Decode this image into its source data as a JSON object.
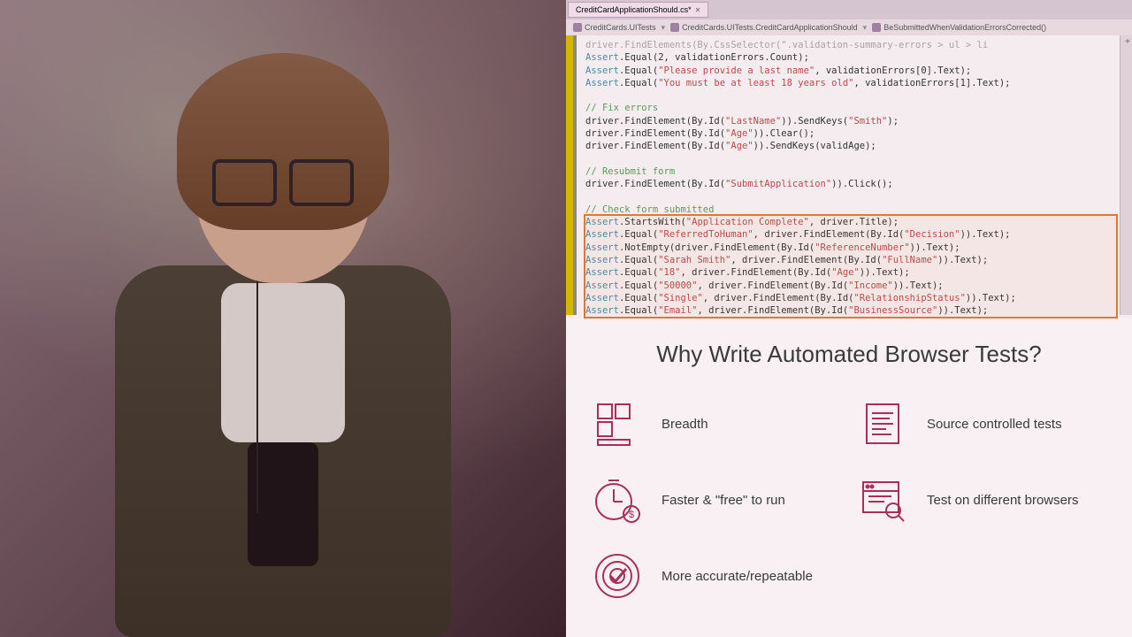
{
  "ide": {
    "tab": {
      "filename": "CreditCardApplicationShould.cs*",
      "close_glyph": "✕"
    },
    "breadcrumb": {
      "project": "CreditCards.UITests",
      "class": "CreditCards.UITests.CreditCardApplicationShould",
      "method": "BeSubmittedWhenValidationErrorsCorrected()"
    },
    "code": {
      "l01a": "driver.FindElements(By.CssSelector(\".validation-summary-errors > ul > li",
      "l02a": "Assert",
      "l02b": ".Equal(",
      "l02c": "2",
      "l02d": ", validationErrors.Count);",
      "l03a": "Assert",
      "l03b": ".Equal(",
      "l03c": "\"Please provide a last name\"",
      "l03d": ", validationErrors[",
      "l03e": "0",
      "l03f": "].Text);",
      "l04a": "Assert",
      "l04b": ".Equal(",
      "l04c": "\"You must be at least 18 years old\"",
      "l04d": ", validationErrors[",
      "l04e": "1",
      "l04f": "].Text);",
      "l06": "// Fix errors",
      "l07a": "driver.FindElement(By.Id(",
      "l07b": "\"LastName\"",
      "l07c": ")).SendKeys(",
      "l07d": "\"Smith\"",
      "l07e": ");",
      "l08a": "driver.FindElement(By.Id(",
      "l08b": "\"Age\"",
      "l08c": ")).Clear();",
      "l09a": "driver.FindElement(By.Id(",
      "l09b": "\"Age\"",
      "l09c": ")).SendKeys(validAge);",
      "l11": "// Resubmit form",
      "l12a": "driver.FindElement(By.Id(",
      "l12b": "\"SubmitApplication\"",
      "l12c": ")).Click();",
      "l14": "// Check form submitted",
      "l15a": "Assert",
      "l15b": ".StartsWith(",
      "l15c": "\"Application Complete\"",
      "l15d": ", driver.Title);",
      "l16a": "Assert",
      "l16b": ".Equal(",
      "l16c": "\"ReferredToHuman\"",
      "l16d": ", driver.FindElement(By.Id(",
      "l16e": "\"Decision\"",
      "l16f": ")).Text);",
      "l17a": "Assert",
      "l17b": ".NotEmpty(driver.FindElement(By.Id(",
      "l17c": "\"ReferenceNumber\"",
      "l17d": ")).Text);",
      "l18a": "Assert",
      "l18b": ".Equal(",
      "l18c": "\"Sarah Smith\"",
      "l18d": ", driver.FindElement(By.Id(",
      "l18e": "\"FullName\"",
      "l18f": ")).Text);",
      "l19a": "Assert",
      "l19b": ".Equal(",
      "l19c": "\"18\"",
      "l19d": ", driver.FindElement(By.Id(",
      "l19e": "\"Age\"",
      "l19f": ")).Text);",
      "l20a": "Assert",
      "l20b": ".Equal(",
      "l20c": "\"50000\"",
      "l20d": ", driver.FindElement(By.Id(",
      "l20e": "\"Income\"",
      "l20f": ")).Text);",
      "l21a": "Assert",
      "l21b": ".Equal(",
      "l21c": "\"Single\"",
      "l21d": ", driver.FindElement(By.Id(",
      "l21e": "\"RelationshipStatus\"",
      "l21f": ")).Text);",
      "l22a": "Assert",
      "l22b": ".Equal(",
      "l22c": "\"Email\"",
      "l22d": ", driver.FindElement(By.Id(",
      "l22e": "\"BusinessSource\"",
      "l22f": ")).Text);",
      "l23": "}"
    }
  },
  "slide": {
    "title": "Why Write Automated Browser Tests?",
    "bullets": {
      "b1": "Breadth",
      "b2": "Source controlled tests",
      "b3": "Faster & \"free\" to run",
      "b4": "Test on different browsers",
      "b5": "More accurate/repeatable"
    }
  }
}
